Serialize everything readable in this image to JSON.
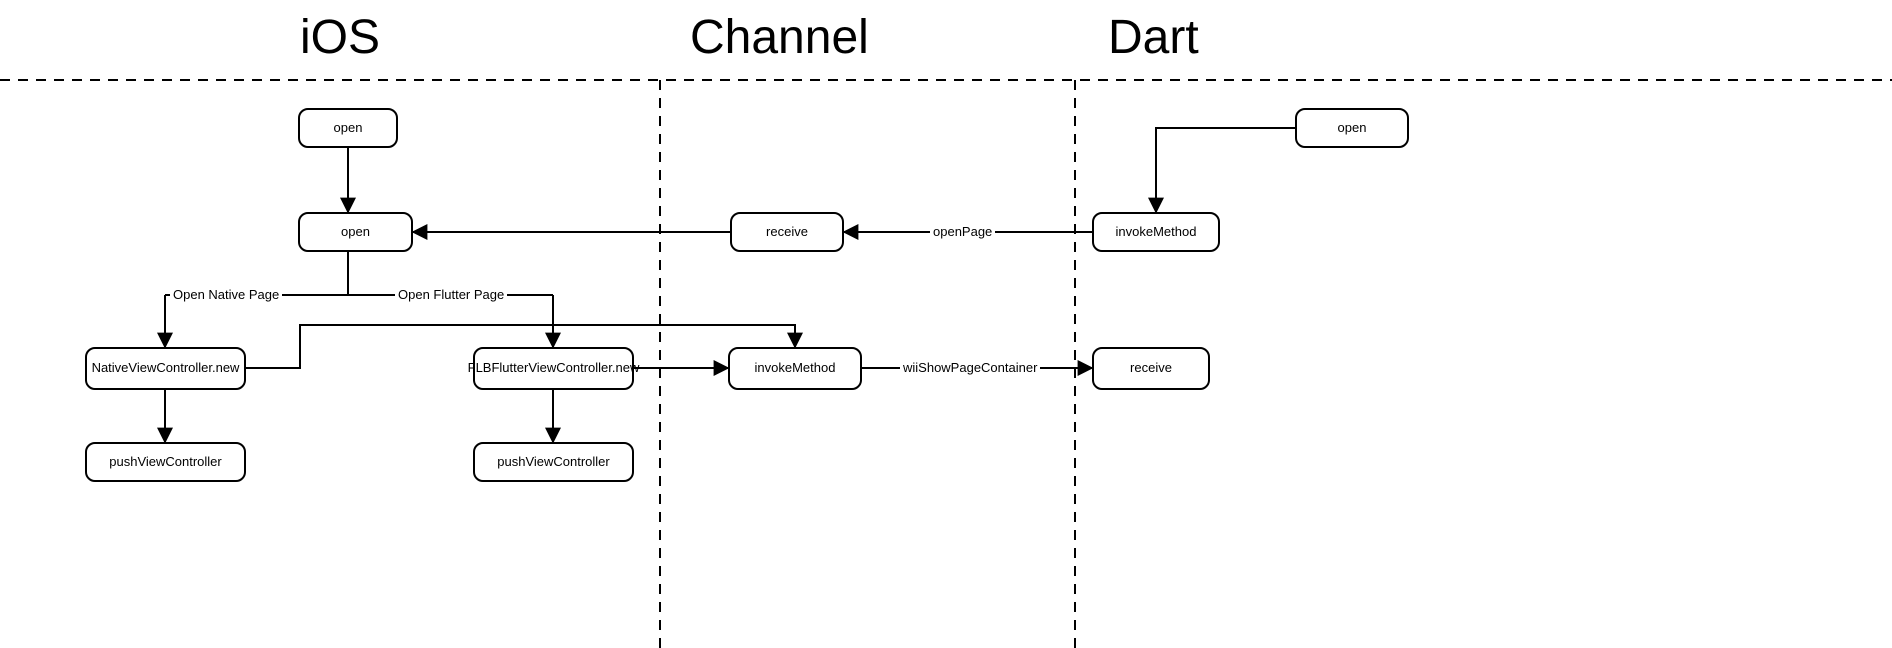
{
  "sections": {
    "ios": "iOS",
    "channel": "Channel",
    "dart": "Dart"
  },
  "nodes": {
    "ios_open_top": "open",
    "ios_open_mid": "open",
    "native_vc_new": "NativeViewController.new",
    "flb_vc_new": "FLBFlutterViewController.new",
    "push_vc_left": "pushViewController",
    "push_vc_right": "pushViewController",
    "ch_receive": "receive",
    "ch_invoke": "invokeMethod",
    "dart_open": "open",
    "dart_invoke": "invokeMethod",
    "dart_receive": "receive"
  },
  "edge_labels": {
    "open_native": "Open Native Page",
    "open_flutter": "Open Flutter Page",
    "open_page": "openPage",
    "wii_show": "wiiShowPageContainer"
  }
}
